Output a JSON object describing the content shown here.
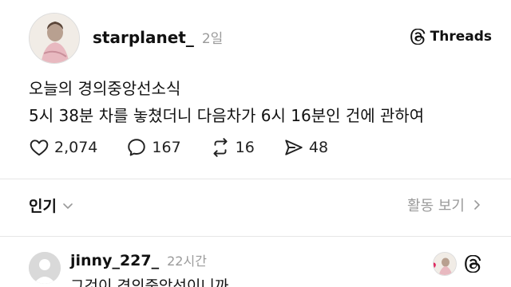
{
  "post": {
    "author": "starplanet_",
    "age": "2일",
    "brand": "Threads",
    "lines": [
      "오늘의 경의중앙선소식",
      "5시 38분 차를 놓쳤더니 다음차가 6시 16분인 건에 관하여"
    ],
    "stats": {
      "likes": "2,074",
      "comments": "167",
      "reposts": "16",
      "shares": "48"
    }
  },
  "sort": {
    "label": "인기",
    "view_activity": "활동 보기"
  },
  "reply": {
    "author": "jinny_227_",
    "age": "22시간",
    "text": "그것이 경의중앙선이니까"
  },
  "icons": {
    "brand": "threads-logo-icon",
    "like": "heart-outline-icon",
    "comment": "comment-bubble-icon",
    "repost": "repost-arrows-icon",
    "share": "send-icon",
    "dropdown": "chevron-down-icon",
    "view": "chevron-right-icon",
    "liked": "heart-filled-icon"
  },
  "colors": {
    "text": "#111111",
    "muted": "#9a9a9a",
    "liked": "#e0245e",
    "divider": "#e6e6e6"
  }
}
